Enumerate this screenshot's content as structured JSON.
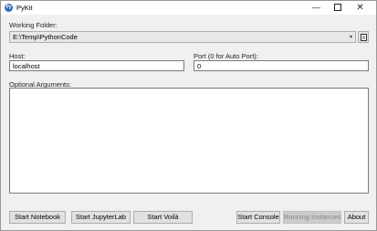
{
  "window": {
    "title": "PyKit",
    "app_icon_glyph": "Py",
    "minimize_glyph": "—",
    "close_glyph": "✕"
  },
  "working_folder": {
    "label": "Working Folder:",
    "value": "E:\\Temp\\PythonCode",
    "dropdown_arrow": "▾",
    "browse_icon": "folder-browse-icon"
  },
  "host": {
    "label": "Host:",
    "value": "localhost"
  },
  "port": {
    "label": "Port (0 for Auto Port):",
    "value": "0"
  },
  "optional_arguments": {
    "label": "Optional Arguments:",
    "value": ""
  },
  "buttons": {
    "start_notebook": "Start Notebook",
    "start_jupyterlab": "Start JupyterLab",
    "start_voila": "Start Voilà",
    "start_console": "Start Console",
    "running_instances": "Running Instances",
    "about": "About"
  },
  "states": {
    "running_instances_enabled": false
  }
}
